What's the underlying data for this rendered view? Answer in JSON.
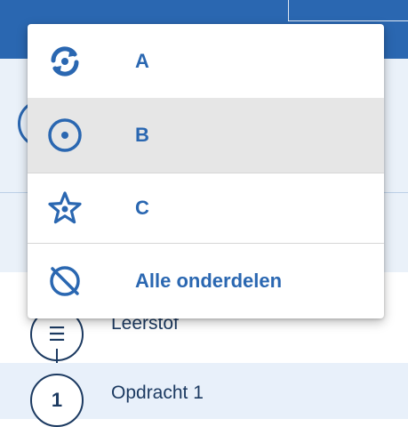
{
  "colors": {
    "primary": "#2a67b1",
    "dark_navy": "#1c3a61",
    "hover_bg": "#e6e6e6",
    "light_bg": "#eaf1f9"
  },
  "menu": {
    "items": [
      {
        "label": "A",
        "icon": "sync-icon"
      },
      {
        "label": "B",
        "icon": "target-icon",
        "highlighted": true
      },
      {
        "label": "C",
        "icon": "star-icon"
      },
      {
        "label": "Alle onderdelen",
        "icon": "hide-icon"
      }
    ]
  },
  "background": {
    "steps": [
      {
        "number_icon": "list-icon",
        "label": "Leerstof"
      },
      {
        "number": "1",
        "label": "Opdracht 1"
      }
    ]
  }
}
